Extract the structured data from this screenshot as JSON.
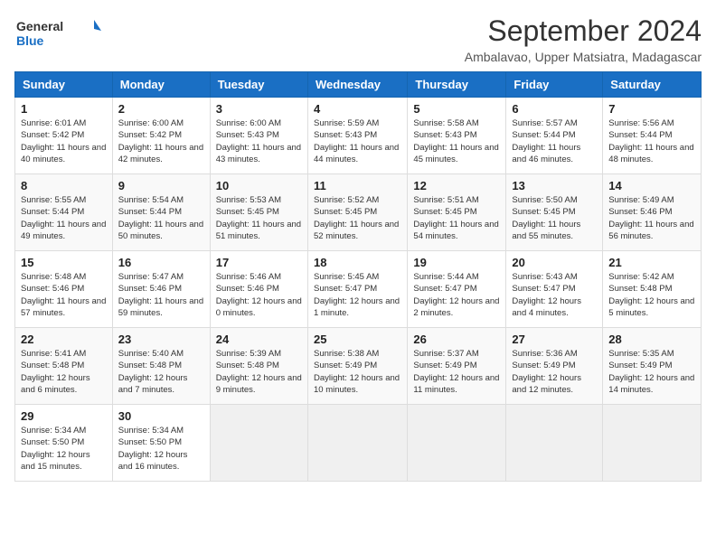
{
  "logo": {
    "line1": "General",
    "line2": "Blue"
  },
  "title": "September 2024",
  "subtitle": "Ambalavao, Upper Matsiatra, Madagascar",
  "days_of_week": [
    "Sunday",
    "Monday",
    "Tuesday",
    "Wednesday",
    "Thursday",
    "Friday",
    "Saturday"
  ],
  "weeks": [
    [
      {
        "day": "1",
        "sunrise": "6:01 AM",
        "sunset": "5:42 PM",
        "daylight": "11 hours and 40 minutes."
      },
      {
        "day": "2",
        "sunrise": "6:00 AM",
        "sunset": "5:42 PM",
        "daylight": "11 hours and 42 minutes."
      },
      {
        "day": "3",
        "sunrise": "6:00 AM",
        "sunset": "5:43 PM",
        "daylight": "11 hours and 43 minutes."
      },
      {
        "day": "4",
        "sunrise": "5:59 AM",
        "sunset": "5:43 PM",
        "daylight": "11 hours and 44 minutes."
      },
      {
        "day": "5",
        "sunrise": "5:58 AM",
        "sunset": "5:43 PM",
        "daylight": "11 hours and 45 minutes."
      },
      {
        "day": "6",
        "sunrise": "5:57 AM",
        "sunset": "5:44 PM",
        "daylight": "11 hours and 46 minutes."
      },
      {
        "day": "7",
        "sunrise": "5:56 AM",
        "sunset": "5:44 PM",
        "daylight": "11 hours and 48 minutes."
      }
    ],
    [
      {
        "day": "8",
        "sunrise": "5:55 AM",
        "sunset": "5:44 PM",
        "daylight": "11 hours and 49 minutes."
      },
      {
        "day": "9",
        "sunrise": "5:54 AM",
        "sunset": "5:44 PM",
        "daylight": "11 hours and 50 minutes."
      },
      {
        "day": "10",
        "sunrise": "5:53 AM",
        "sunset": "5:45 PM",
        "daylight": "11 hours and 51 minutes."
      },
      {
        "day": "11",
        "sunrise": "5:52 AM",
        "sunset": "5:45 PM",
        "daylight": "11 hours and 52 minutes."
      },
      {
        "day": "12",
        "sunrise": "5:51 AM",
        "sunset": "5:45 PM",
        "daylight": "11 hours and 54 minutes."
      },
      {
        "day": "13",
        "sunrise": "5:50 AM",
        "sunset": "5:45 PM",
        "daylight": "11 hours and 55 minutes."
      },
      {
        "day": "14",
        "sunrise": "5:49 AM",
        "sunset": "5:46 PM",
        "daylight": "11 hours and 56 minutes."
      }
    ],
    [
      {
        "day": "15",
        "sunrise": "5:48 AM",
        "sunset": "5:46 PM",
        "daylight": "11 hours and 57 minutes."
      },
      {
        "day": "16",
        "sunrise": "5:47 AM",
        "sunset": "5:46 PM",
        "daylight": "11 hours and 59 minutes."
      },
      {
        "day": "17",
        "sunrise": "5:46 AM",
        "sunset": "5:46 PM",
        "daylight": "12 hours and 0 minutes."
      },
      {
        "day": "18",
        "sunrise": "5:45 AM",
        "sunset": "5:47 PM",
        "daylight": "12 hours and 1 minute."
      },
      {
        "day": "19",
        "sunrise": "5:44 AM",
        "sunset": "5:47 PM",
        "daylight": "12 hours and 2 minutes."
      },
      {
        "day": "20",
        "sunrise": "5:43 AM",
        "sunset": "5:47 PM",
        "daylight": "12 hours and 4 minutes."
      },
      {
        "day": "21",
        "sunrise": "5:42 AM",
        "sunset": "5:48 PM",
        "daylight": "12 hours and 5 minutes."
      }
    ],
    [
      {
        "day": "22",
        "sunrise": "5:41 AM",
        "sunset": "5:48 PM",
        "daylight": "12 hours and 6 minutes."
      },
      {
        "day": "23",
        "sunrise": "5:40 AM",
        "sunset": "5:48 PM",
        "daylight": "12 hours and 7 minutes."
      },
      {
        "day": "24",
        "sunrise": "5:39 AM",
        "sunset": "5:48 PM",
        "daylight": "12 hours and 9 minutes."
      },
      {
        "day": "25",
        "sunrise": "5:38 AM",
        "sunset": "5:49 PM",
        "daylight": "12 hours and 10 minutes."
      },
      {
        "day": "26",
        "sunrise": "5:37 AM",
        "sunset": "5:49 PM",
        "daylight": "12 hours and 11 minutes."
      },
      {
        "day": "27",
        "sunrise": "5:36 AM",
        "sunset": "5:49 PM",
        "daylight": "12 hours and 12 minutes."
      },
      {
        "day": "28",
        "sunrise": "5:35 AM",
        "sunset": "5:49 PM",
        "daylight": "12 hours and 14 minutes."
      }
    ],
    [
      {
        "day": "29",
        "sunrise": "5:34 AM",
        "sunset": "5:50 PM",
        "daylight": "12 hours and 15 minutes."
      },
      {
        "day": "30",
        "sunrise": "5:34 AM",
        "sunset": "5:50 PM",
        "daylight": "12 hours and 16 minutes."
      },
      null,
      null,
      null,
      null,
      null
    ]
  ],
  "labels": {
    "sunrise": "Sunrise: ",
    "sunset": "Sunset: ",
    "daylight": "Daylight: "
  }
}
